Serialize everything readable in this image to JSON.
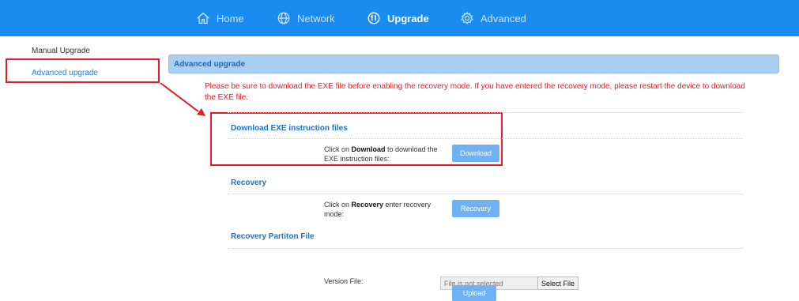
{
  "nav": {
    "items": [
      {
        "label": "Home",
        "icon": "home-icon"
      },
      {
        "label": "Network",
        "icon": "globe-icon"
      },
      {
        "label": "Upgrade",
        "icon": "upgrade-icon"
      },
      {
        "label": "Advanced",
        "icon": "gear-icon"
      }
    ],
    "active": "Upgrade"
  },
  "sidebar": {
    "items": [
      {
        "label": "Manual Upgrade"
      },
      {
        "label": "Advanced upgrade"
      }
    ],
    "active": "Advanced upgrade"
  },
  "main": {
    "header": "Advanced upgrade",
    "warning": "Please be sure to download the EXE file before enabling the recovery mode. If you have entered the recovery mode, please restart the device to download the EXE file.",
    "download": {
      "title": "Download EXE instruction files",
      "desc_pre": "Click on ",
      "desc_bold": "Download",
      "desc_post": " to download the EXE instruction files:",
      "button": "Download"
    },
    "recovery": {
      "title": "Recovery",
      "desc_pre": "Click on ",
      "desc_bold": "Recovery",
      "desc_post": " enter recovery mode:",
      "button": "Recovery"
    },
    "partition": {
      "title": "Recovery Partiton File",
      "version_label": "Version File:",
      "file_placeholder": "File is not selected",
      "select_button": "Select File",
      "upload_button": "Upload"
    }
  },
  "colors": {
    "topbar": "#1a8cf0",
    "accent": "#1a7fe0",
    "warning": "#e51c23",
    "button": "#6fb2f3",
    "annotation": "#e51c23"
  }
}
